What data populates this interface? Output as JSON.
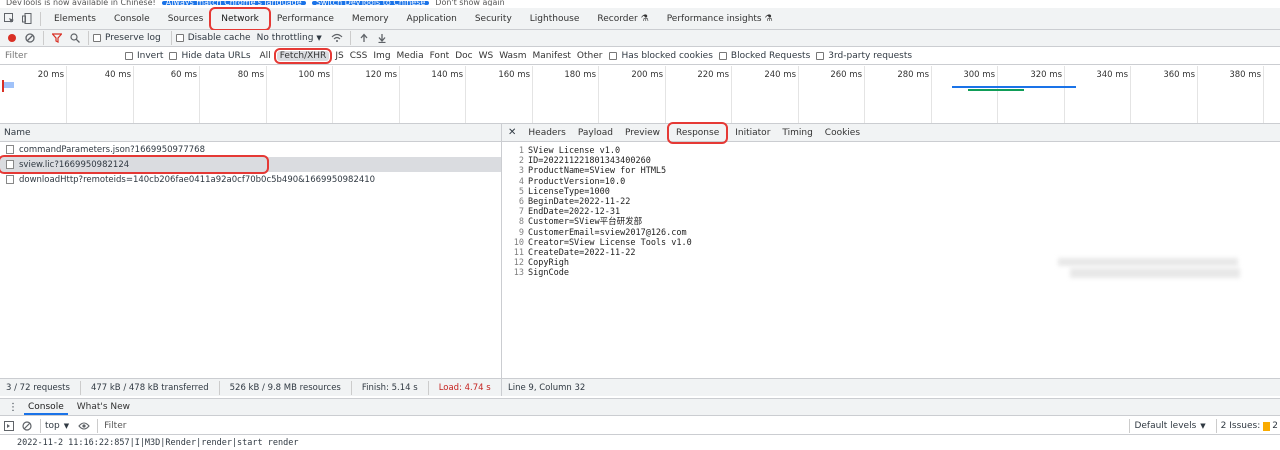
{
  "infobar": {
    "text": "DevTools is now available in Chinese!",
    "btn1": "Always match Chrome's language",
    "btn2": "Switch DevTools to Chinese",
    "btn3": "Don't show again"
  },
  "main_tabs": [
    "Elements",
    "Console",
    "Sources",
    "Network",
    "Performance",
    "Memory",
    "Application",
    "Security",
    "Lighthouse",
    "Recorder",
    "Performance insights"
  ],
  "active_main_tab": "Network",
  "toolbar": {
    "preserve_log": "Preserve log",
    "disable_cache": "Disable cache",
    "throttling": "No throttling"
  },
  "filterbar": {
    "placeholder": "Filter",
    "invert": "Invert",
    "hide_data_urls": "Hide data URLs",
    "types": [
      "All",
      "Fetch/XHR",
      "JS",
      "CSS",
      "Img",
      "Media",
      "Font",
      "Doc",
      "WS",
      "Wasm",
      "Manifest",
      "Other"
    ],
    "active_type": "Fetch/XHR",
    "blocked_cookies": "Has blocked cookies",
    "blocked_requests": "Blocked Requests",
    "third_party": "3rd-party requests"
  },
  "overview": {
    "ticks": [
      "20 ms",
      "40 ms",
      "60 ms",
      "80 ms",
      "100 ms",
      "120 ms",
      "140 ms",
      "160 ms",
      "180 ms",
      "200 ms",
      "220 ms",
      "240 ms",
      "260 ms",
      "280 ms",
      "300 ms",
      "320 ms",
      "340 ms",
      "360 ms",
      "380 ms"
    ]
  },
  "requests": {
    "header": "Name",
    "items": [
      "commandParameters.json?1669950977768",
      "sview.lic?1669950982124",
      "downloadHttp?remoteids=140cb206fae0411a92a0cf70b0c5b490&1669950982410"
    ],
    "selected_index": 1
  },
  "detail_tabs": [
    "Headers",
    "Payload",
    "Preview",
    "Response",
    "Initiator",
    "Timing",
    "Cookies"
  ],
  "active_detail_tab": "Response",
  "response_lines": [
    "SView License v1.0",
    "ID=20221122180134340026​0",
    "ProductName=SView for HTML5",
    "ProductVersion=10.0",
    "LicenseType=1000",
    "BeginDate=2022-11-22",
    "EndDate=2022-12-31",
    "Customer=SView平台研发部",
    "CustomerEmail=sview2017@126.com",
    "Creator=SView License Tools v1.0",
    "CreateDate=2022-11-22",
    "CopyRigh",
    "SignCode"
  ],
  "status_left": {
    "requests": "3 / 72 requests",
    "transferred": "477 kB / 478 kB transferred",
    "resources": "526 kB / 9.8 MB resources",
    "finish": "Finish: 5.14 s",
    "load": "Load: 4.74 s"
  },
  "status_right": "Line 9, Column 32",
  "drawer": {
    "tabs": [
      "Console",
      "What's New"
    ],
    "active": "Console",
    "context": "top",
    "filter_placeholder": "Filter",
    "levels": "Default levels",
    "issues": "2 Issues:",
    "issue_count": "2",
    "log_line": "2022-11-2 11:16:22:857|I|M3D|Render|render|start render"
  },
  "colors": {
    "accent": "#1a73e8",
    "highlight_box": "#e53935",
    "record": "#d93025",
    "load_text": "#c5221f"
  }
}
